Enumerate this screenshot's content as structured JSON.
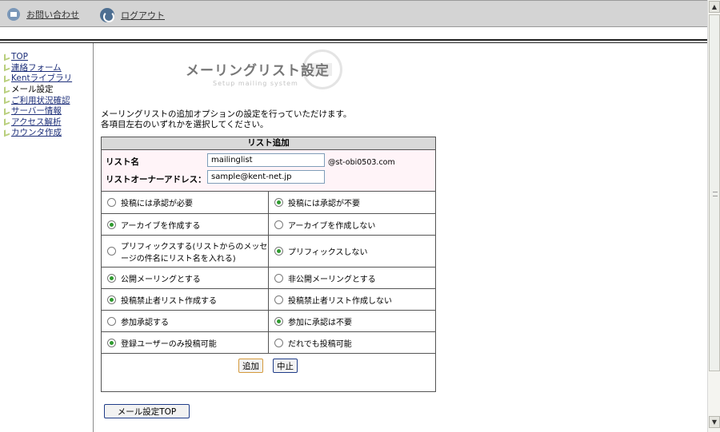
{
  "header": {
    "contact_label": "お問い合わせ",
    "logout_label": "ログアウト",
    "contact_icon": "mail-icon",
    "logout_icon": "logout-icon"
  },
  "sidebar": {
    "items": [
      {
        "label": "TOP"
      },
      {
        "label": "連絡フォーム"
      },
      {
        "label": "Kentライブラリ"
      },
      {
        "label": "メール設定"
      },
      {
        "label": "ご利用状況確認"
      },
      {
        "label": "サーバー情報"
      },
      {
        "label": "アクセス解析"
      },
      {
        "label": "カウンタ作成"
      }
    ]
  },
  "page": {
    "title": "メーリングリスト設定",
    "subtitle": "Setup mailing system",
    "intro_line1": "メーリングリストの追加オプションの設定を行っていただけます。",
    "intro_line2": "各項目左右のいずれかを選択してください。"
  },
  "form": {
    "heading": "リスト追加",
    "list_name_label": "リスト名",
    "list_name_value": "mailinglist",
    "domain": "@st-obi0503.com",
    "owner_label": "リストオーナーアドレス：",
    "owner_value": "sample@kent-net.jp",
    "options": [
      {
        "left": "投稿には承認が必要",
        "right": "投稿には承認が不要",
        "selected": "right"
      },
      {
        "left": "アーカイブを作成する",
        "right": "アーカイブを作成しない",
        "selected": "left"
      },
      {
        "left": "プリフィックスする(リストからのメッセージの件名にリスト名を入れる)",
        "right": "プリフィックスしない",
        "selected": "right"
      },
      {
        "left": "公開メーリングとする",
        "right": "非公開メーリングとする",
        "selected": "left"
      },
      {
        "left": "投稿禁止者リスト作成する",
        "right": "投稿禁止者リスト作成しない",
        "selected": "left"
      },
      {
        "left": "参加承認する",
        "right": "参加に承認は不要",
        "selected": "right"
      },
      {
        "left": "登録ユーザーのみ投稿可能",
        "right": "だれでも投稿可能",
        "selected": "left"
      }
    ],
    "add_button": "追加",
    "cancel_button": "中止"
  },
  "footer": {
    "mail_top_button": "メール設定TOP"
  },
  "scrollbar": {
    "up_icon": "arrow-up-icon",
    "down_icon": "arrow-down-icon"
  },
  "colors": {
    "header_bg": "#d4d4d4",
    "link": "#1d2f7a",
    "radio_selected": "#2f9a2f",
    "fields_bg": "#fff4f8"
  }
}
